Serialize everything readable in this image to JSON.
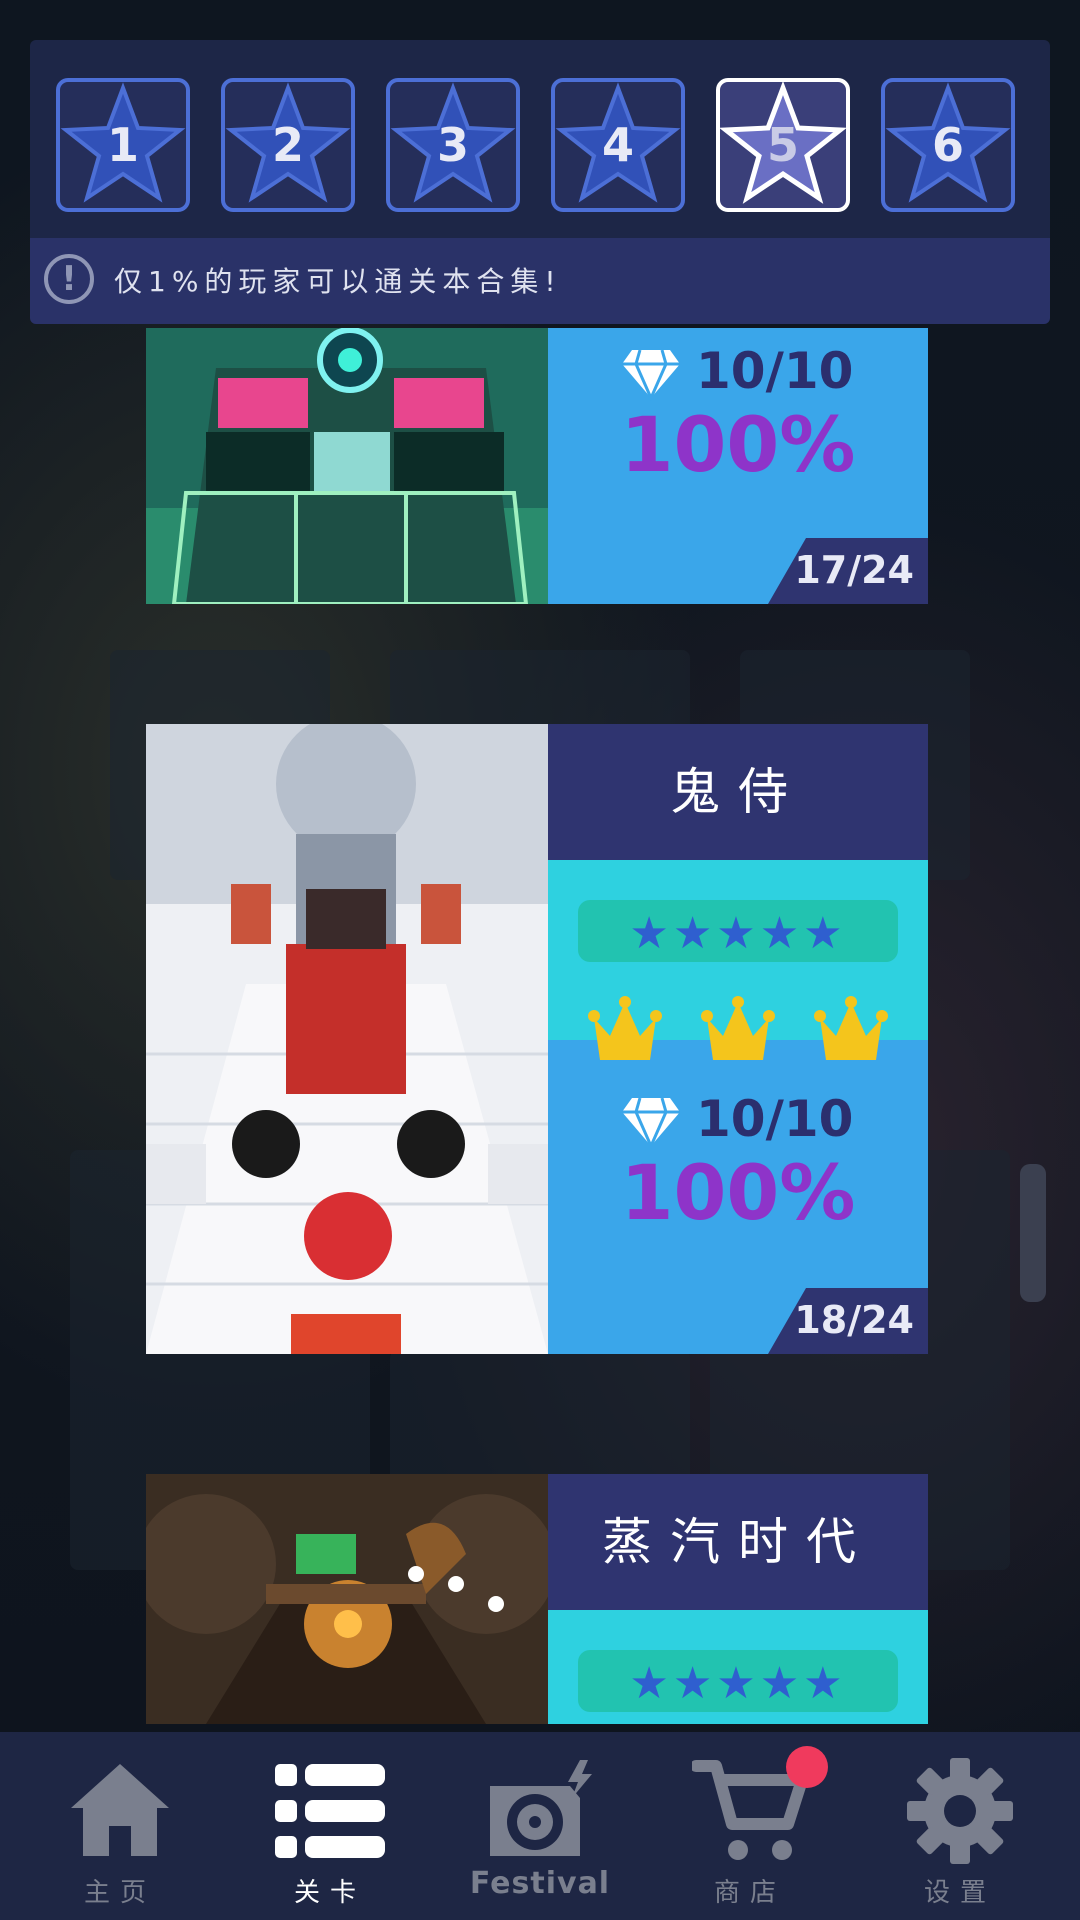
{
  "tabs": {
    "items": [
      {
        "number": "1",
        "active": false
      },
      {
        "number": "2",
        "active": false
      },
      {
        "number": "3",
        "active": false
      },
      {
        "number": "4",
        "active": false
      },
      {
        "number": "5",
        "active": true
      },
      {
        "number": "6",
        "active": false
      }
    ]
  },
  "notice": {
    "icon": "exclamation-circle-icon",
    "text": "仅1%的玩家可以通关本合集!"
  },
  "levels": [
    {
      "gems": "10/10",
      "percent": "100%",
      "progress": "17/24"
    },
    {
      "title": "鬼侍",
      "stars": "★★★★★",
      "crowns": 3,
      "gems": "10/10",
      "percent": "100%",
      "progress": "18/24"
    },
    {
      "title": "蒸汽时代",
      "stars": "★★★★★"
    }
  ],
  "nav": {
    "items": [
      {
        "label": "主页",
        "icon": "home-icon",
        "active": false
      },
      {
        "label": "关卡",
        "icon": "list-icon",
        "active": true
      },
      {
        "label": "Festival",
        "icon": "festival-disc-icon",
        "active": false
      },
      {
        "label": "商店",
        "icon": "cart-icon",
        "active": false
      },
      {
        "label": "设置",
        "icon": "gear-icon",
        "active": false
      }
    ]
  },
  "colors": {
    "panel": "#1d2647",
    "accent_blue": "#4c6fd6",
    "card_blue": "#3aa6ea",
    "card_cyan": "#2ed1e0",
    "percent_purple": "#8e34c9",
    "crown_gold": "#f4c51c",
    "badge_red": "#f03a5d"
  }
}
